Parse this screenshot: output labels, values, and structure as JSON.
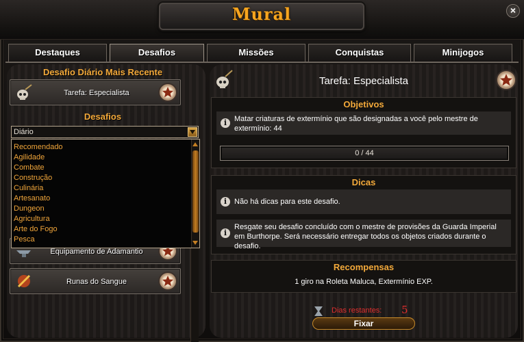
{
  "window": {
    "title": "Mural"
  },
  "tabs": [
    {
      "label": "Destaques"
    },
    {
      "label": "Desafios"
    },
    {
      "label": "Missões"
    },
    {
      "label": "Conquistas"
    },
    {
      "label": "Minijogos"
    }
  ],
  "left": {
    "recent_title": "Desafio Diário Mais Recente",
    "recent_challenge": "Tarefa: Especialista",
    "challenges_title": "Desafios",
    "filter": {
      "selected": "Diário",
      "options": [
        "Recomendado",
        "Agilidade",
        "Combate",
        "Construção",
        "Culinária",
        "Artesanato",
        "Dungeon",
        "Agricultura",
        "Arte do Fogo",
        "Pesca"
      ]
    },
    "challenge_list": [
      {
        "label": "Equipamento de Adamantio"
      },
      {
        "label": "Runas do Sangue"
      }
    ]
  },
  "right": {
    "task_title": "Tarefa: Especialista",
    "objectives": {
      "title": "Objetivos",
      "text": "Matar criaturas de extermínio que são designadas a você pelo mestre de extermínio: 44",
      "progress_text": "0 / 44",
      "progress_current": 0,
      "progress_total": 44
    },
    "tips": {
      "title": "Dicas",
      "items": [
        "Não há dicas para este desafio.",
        "Resgate seu desafio concluído com o mestre de provisões da Guarda Imperial em Burthorpe. Será necessário entregar todos os objetos criados durante o desafio."
      ]
    },
    "rewards": {
      "title": "Recompensas",
      "text": "1 giro na Roleta Maluca, Extermínio EXP."
    },
    "days_label": "Dias restantes:",
    "days_value": "5",
    "fix_button": "Fixar"
  }
}
